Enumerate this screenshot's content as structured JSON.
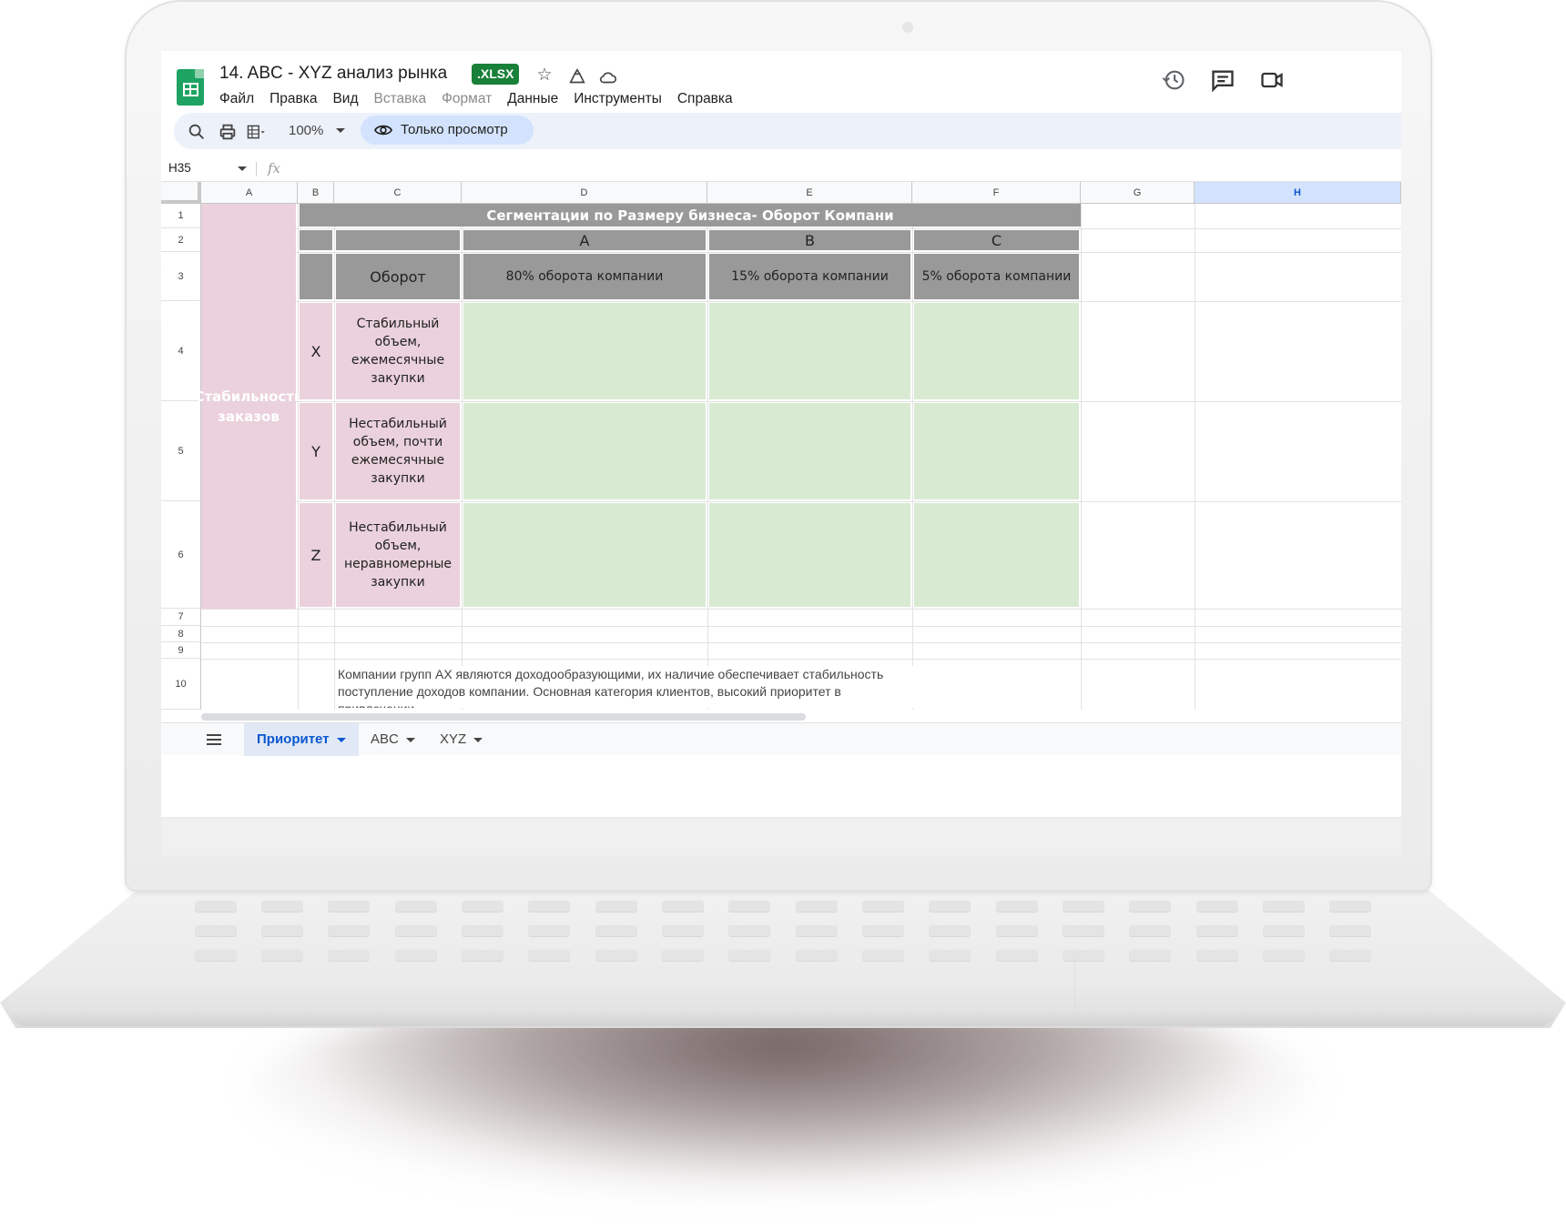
{
  "app": {
    "doc_title": "14. ABC - XYZ анализ рынка",
    "file_badge": ".XLSX",
    "menu": [
      "Файл",
      "Правка",
      "Вид",
      "Вставка",
      "Формат",
      "Данные",
      "Инструменты",
      "Справка"
    ],
    "menu_disabled": [
      "Вставка",
      "Формат"
    ],
    "toolbar": {
      "zoom": "100%",
      "view_only_label": "Только просмотр"
    },
    "formula_bar": {
      "cell_ref": "H35",
      "fx_symbol": "fx",
      "content": ""
    }
  },
  "grid": {
    "columns": [
      "A",
      "B",
      "C",
      "D",
      "E",
      "F",
      "G",
      "H"
    ],
    "selected_column": "H",
    "rows": [
      "1",
      "2",
      "3",
      "4",
      "5",
      "6",
      "7",
      "8",
      "9",
      "10"
    ],
    "cells": {
      "title": "Сегментации по Размеру бизнеса- Оборот Компани",
      "header_a": "A",
      "header_b": "B",
      "header_c": "C",
      "turnover_label": "Оборот",
      "pct_a": "80% оборота компании",
      "pct_b": "15% оборота компании",
      "pct_c": "5% оборота компании",
      "stability_label": "Стабильность заказов",
      "x_letter": "X",
      "x_desc": "Стабильный объем, ежемесячные закупки",
      "y_letter": "Y",
      "y_desc": "Нестабильный объем, почти ежемесячные закупки",
      "z_letter": "Z",
      "z_desc": "Нестабильный объем, неравномерные закупки",
      "note": "Компании групп АХ являются доходообразующими, их наличие обеспечивает стабильность поступление доходов компании. Основная категория клиентов, высокий приоритет в привлечении."
    },
    "colors": {
      "gray": "#999999",
      "pink": "#ead1dc",
      "green": "#d9ead3"
    }
  },
  "sheets": {
    "tabs": [
      {
        "label": "Приоритет",
        "active": true
      },
      {
        "label": "ABC",
        "active": false
      },
      {
        "label": "XYZ",
        "active": false
      }
    ]
  },
  "icons": [
    "sheets-logo-icon",
    "star-icon",
    "move-to-drive-icon",
    "cloud-status-icon",
    "history-icon",
    "comments-icon",
    "meet-icon",
    "search-icon",
    "print-icon",
    "format-icon",
    "eye-icon",
    "all-sheets-icon"
  ]
}
